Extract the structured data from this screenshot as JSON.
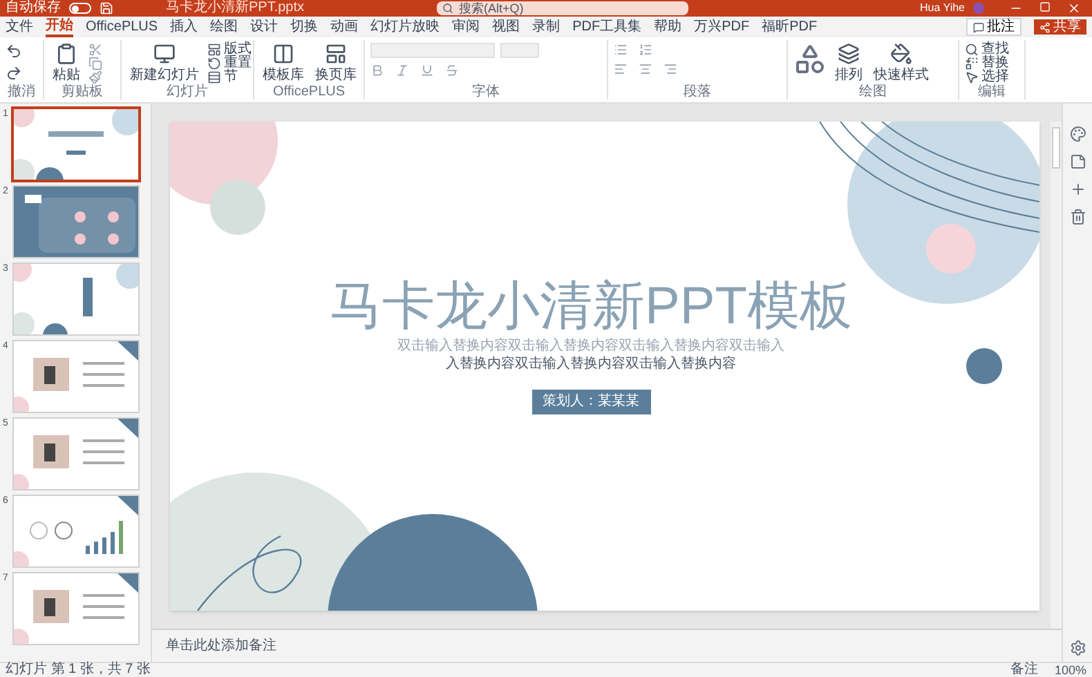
{
  "title_bar": {
    "autosave_label": "自动保存",
    "autosave_on": false,
    "file_name": "马卡龙小清新PPT.pptx",
    "search_placeholder": "搜索(Alt+Q)",
    "user_name": "Hua Yihe"
  },
  "menu_tabs": [
    {
      "label": "文件",
      "selected": false
    },
    {
      "label": "开始",
      "selected": true
    },
    {
      "label": "OfficePLUS",
      "selected": false
    },
    {
      "label": "插入",
      "selected": false
    },
    {
      "label": "绘图",
      "selected": false
    },
    {
      "label": "设计",
      "selected": false
    },
    {
      "label": "切换",
      "selected": false
    },
    {
      "label": "动画",
      "selected": false
    },
    {
      "label": "幻灯片放映",
      "selected": false
    },
    {
      "label": "审阅",
      "selected": false
    },
    {
      "label": "视图",
      "selected": false
    },
    {
      "label": "录制",
      "selected": false
    },
    {
      "label": "PDF工具集",
      "selected": false
    },
    {
      "label": "帮助",
      "selected": false
    },
    {
      "label": "万兴PDF",
      "selected": false
    },
    {
      "label": "福昕PDF",
      "selected": false
    }
  ],
  "comments_button": "批注",
  "share_button": "共享",
  "ribbon": {
    "groups": [
      "撤消",
      "剪贴板",
      "幻灯片",
      "OfficePLUS",
      "字体",
      "段落",
      "绘图",
      "编辑"
    ],
    "paste": "粘贴",
    "new_slide": "新建幻灯片",
    "layout": "版式",
    "reset": "重置",
    "section": "节",
    "template_library": "模板库",
    "page_library": "换页库",
    "arrange": "排列",
    "quick_styles": "快速样式",
    "find": "查找",
    "replace": "替换",
    "select": "选择"
  },
  "thumbnails": [
    {
      "number": "1",
      "kind": "title",
      "selected": true
    },
    {
      "number": "2",
      "kind": "contents",
      "selected": false
    },
    {
      "number": "3",
      "kind": "section",
      "selected": false
    },
    {
      "number": "4",
      "kind": "photo",
      "selected": false
    },
    {
      "number": "5",
      "kind": "photo",
      "selected": false
    },
    {
      "number": "6",
      "kind": "chart",
      "selected": false
    },
    {
      "number": "7",
      "kind": "photo",
      "selected": false
    }
  ],
  "slide": {
    "title": "马卡龙小清新PPT模板",
    "subtitle_lines": [
      "双击输入替换内容双击输入替换内容双击输入替换内容双击输入",
      "入替换内容双击输入替换内容双击输入替换内容"
    ],
    "presenter": "策划人：某某某"
  },
  "notes_placeholder": "单击此处添加备注",
  "status_bar": {
    "slide_info": "幻灯片 第 1 张，共 7 张",
    "notes": "备注",
    "zoom": "100%"
  }
}
